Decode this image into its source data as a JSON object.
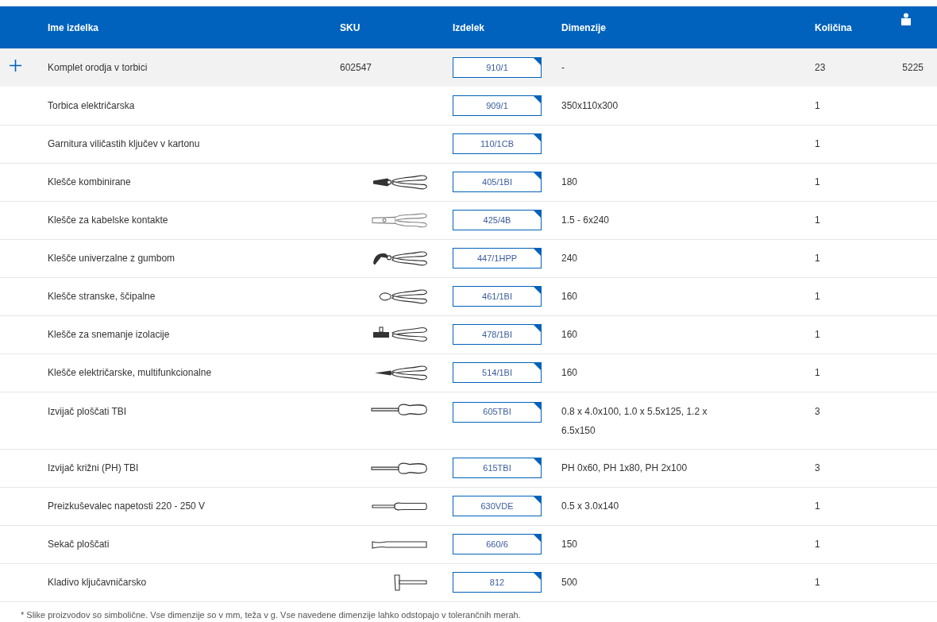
{
  "columns": [
    {
      "label": "Ime izdelka"
    },
    {
      "label": "SKU"
    },
    {
      "label": "Izdelek"
    },
    {
      "label": "Dimenzije"
    },
    {
      "label": "Količina"
    },
    {
      "kind": "weight"
    }
  ],
  "rows": [
    {
      "kind": "set",
      "name": "Komplet orodja v torbici",
      "sku": "602547",
      "code": "910/1",
      "dimensions": "-",
      "quantity": "23",
      "weight": "5225"
    },
    {
      "kind": "part",
      "name": "Torbica električarska",
      "code": "909/1",
      "dimensions": "350x110x300",
      "quantity": "1"
    },
    {
      "kind": "part",
      "name": "Garnitura viličastih ključev v kartonu",
      "code": "110/1CB",
      "quantity": "1"
    },
    {
      "kind": "combination-pliers",
      "name": "Klešče kombinirane",
      "code": "405/1BI",
      "dimensions": "180",
      "quantity": "1"
    },
    {
      "kind": "crimping-pliers",
      "name": "Klešče za kabelske kontakte",
      "code": "425/4B",
      "dimensions": "1.5 - 6x240",
      "quantity": "1"
    },
    {
      "kind": "pump-pliers",
      "name": "Klešče univerzalne z gumbom",
      "code": "447/1HPP",
      "dimensions": "240",
      "quantity": "1"
    },
    {
      "kind": "side-cutter",
      "name": "Klešče stranske, ščipalne",
      "code": "461/1BI",
      "dimensions": "160",
      "quantity": "1"
    },
    {
      "kind": "stripping-pliers",
      "name": "Klešče za snemanje izolacije",
      "code": "478/1BI",
      "dimensions": "160",
      "quantity": "1"
    },
    {
      "kind": "needle-pliers",
      "name": "Klešče električarske, multifunkcionalne",
      "code": "514/1BI",
      "dimensions": "160",
      "quantity": "1"
    },
    {
      "kind": "screwdriver",
      "name": "Izvijač ploščati TBI",
      "code": "605TBI",
      "dimensions": "0.8 x 4.0x100, 1.0 x 5.5x125, 1.2 x 6.5x150",
      "quantity": "3"
    },
    {
      "kind": "screwdriver",
      "name": "Izvijač križni (PH) TBI",
      "code": "615TBI",
      "dimensions": "PH 0x60, PH 1x80, PH 2x100",
      "quantity": "3"
    },
    {
      "kind": "tester",
      "name": "Preizkuševalec napetosti 220 - 250 V",
      "code": "630VDE",
      "dimensions": "0.5 x 3.0x140",
      "quantity": "1"
    },
    {
      "kind": "chisel",
      "name": "Sekač ploščati",
      "code": "660/6",
      "dimensions": "150",
      "quantity": "1"
    },
    {
      "kind": "hammer",
      "name": "Kladivo ključavničarsko",
      "code": "812",
      "dimensions": "500",
      "quantity": "1"
    }
  ],
  "footnote": "* Slike proizvodov so simbolične. Vse dimenzije so v mm, teža v g. Vse navedene dimenzije lahko odstopajo v tolerančnih merah."
}
